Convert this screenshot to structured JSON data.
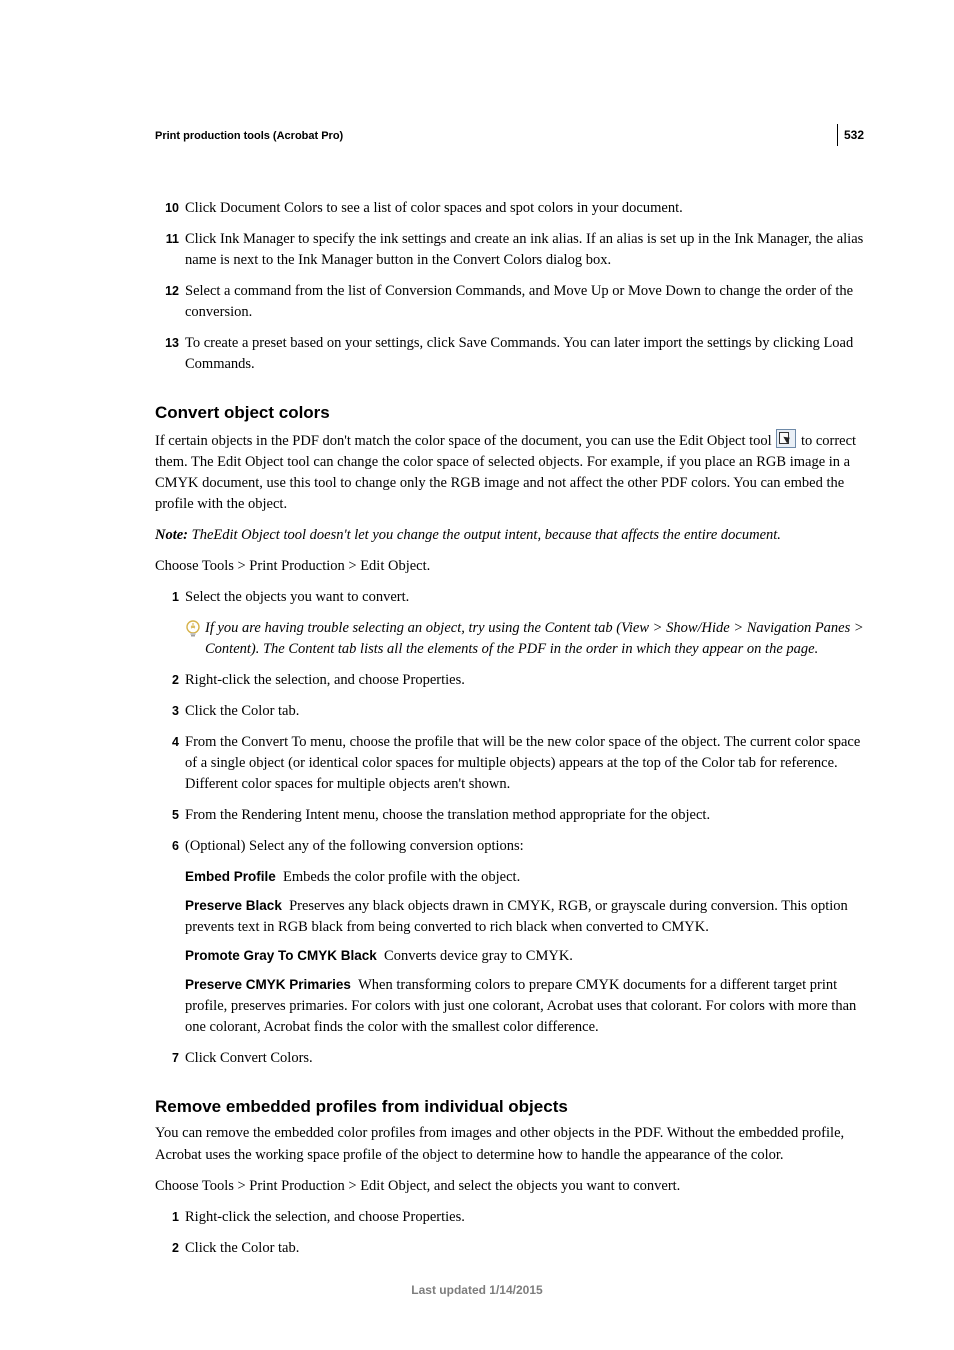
{
  "page_number": "532",
  "running_head": "Print production tools (Acrobat Pro)",
  "top_list": [
    {
      "n": "10",
      "t": "Click Document Colors to see a list of color spaces and spot colors in your document."
    },
    {
      "n": "11",
      "t": "Click Ink Manager to specify the ink settings and create an ink alias. If an alias is set up in the Ink Manager, the alias name is next to the Ink Manager button in the Convert Colors dialog box."
    },
    {
      "n": "12",
      "t": "Select a command from the list of Conversion Commands, and Move Up or Move Down to change the order of the conversion."
    },
    {
      "n": "13",
      "t": "To create a preset based on your settings, click Save Commands. You can later import the settings by clicking Load Commands."
    }
  ],
  "sec1": {
    "title": "Convert object colors",
    "intro_pre": "If certain objects in the PDF don't match the color space of the document, you can use the Edit Object tool ",
    "intro_post": "to correct them. The Edit Object tool can change the color space of selected objects. For example, if you place an RGB image in a CMYK document, use this tool to change only the RGB image and not affect the other PDF colors. You can embed the profile with the object.",
    "note_label": "Note:",
    "note_body": " TheEdit Object tool doesn't let you change the output intent, because that affects the entire document.",
    "lead": "Choose Tools > Print Production > Edit Object.",
    "step1": {
      "n": "1",
      "t": "Select the objects you want to convert."
    },
    "tip": "If you are having trouble selecting an object, try using the Content tab (View > Show/Hide > Navigation Panes > Content). The Content tab lists all the elements of the PDF in the order in which they appear on the page.",
    "steps_rest": [
      {
        "n": "2",
        "t": "Right-click the selection, and choose Properties."
      },
      {
        "n": "3",
        "t": "Click the Color tab."
      },
      {
        "n": "4",
        "t": "From the Convert To menu, choose the profile that will be the new color space of the object. The current color space of a single object (or identical color spaces for multiple objects) appears at the top of the Color tab for reference. Different color spaces for multiple objects aren't shown."
      },
      {
        "n": "5",
        "t": "From the Rendering Intent menu, choose the translation method appropriate for the object."
      }
    ],
    "step6": {
      "n": "6",
      "t": "(Optional) Select any of the following conversion options:"
    },
    "opts": [
      {
        "h": "Embed Profile",
        "b": "Embeds the color profile with the object."
      },
      {
        "h": "Preserve Black",
        "b": "Preserves any black objects drawn in CMYK, RGB, or grayscale during conversion. This option prevents text in RGB black from being converted to rich black when converted to CMYK."
      },
      {
        "h": "Promote Gray To CMYK Black",
        "b": "Converts device gray to CMYK."
      },
      {
        "h": "Preserve CMYK Primaries",
        "b": "When transforming colors to prepare CMYK documents for a different target print profile, preserves primaries. For colors with just one colorant, Acrobat uses that colorant. For colors with more than one colorant, Acrobat finds the color with the smallest color difference."
      }
    ],
    "step7": {
      "n": "7",
      "t": "Click Convert Colors."
    }
  },
  "sec2": {
    "title": "Remove embedded profiles from individual objects",
    "intro": "You can remove the embedded color profiles from images and other objects in the PDF. Without the embedded profile, Acrobat uses the working space profile of the object to determine how to handle the appearance of the color.",
    "lead": "Choose Tools > Print Production > Edit Object, and select the objects you want to convert.",
    "steps": [
      {
        "n": "1",
        "t": "Right-click the selection, and choose Properties."
      },
      {
        "n": "2",
        "t": "Click the Color tab."
      }
    ]
  },
  "footer": "Last updated 1/14/2015"
}
